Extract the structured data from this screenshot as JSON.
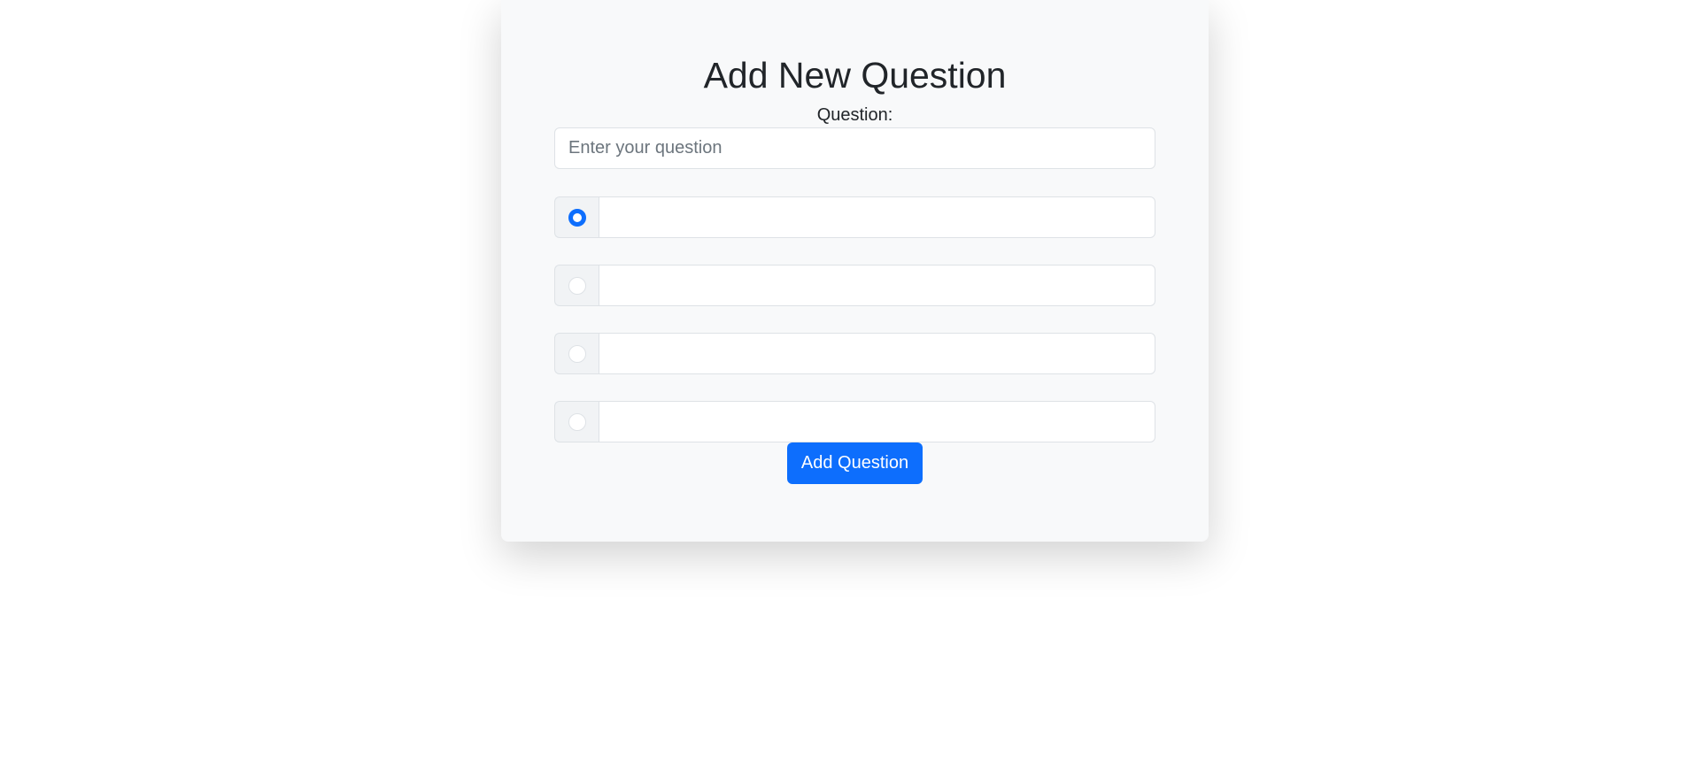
{
  "form": {
    "title": "Add New Question",
    "question_label": "Question:",
    "question_placeholder": "Enter your question",
    "question_value": "",
    "options": [
      {
        "selected": true,
        "value": ""
      },
      {
        "selected": false,
        "value": ""
      },
      {
        "selected": false,
        "value": ""
      },
      {
        "selected": false,
        "value": ""
      }
    ],
    "submit_label": "Add Question"
  },
  "colors": {
    "accent": "#0d6efd",
    "card_background": "#f8f9fa",
    "page_background": "#ffffff"
  }
}
